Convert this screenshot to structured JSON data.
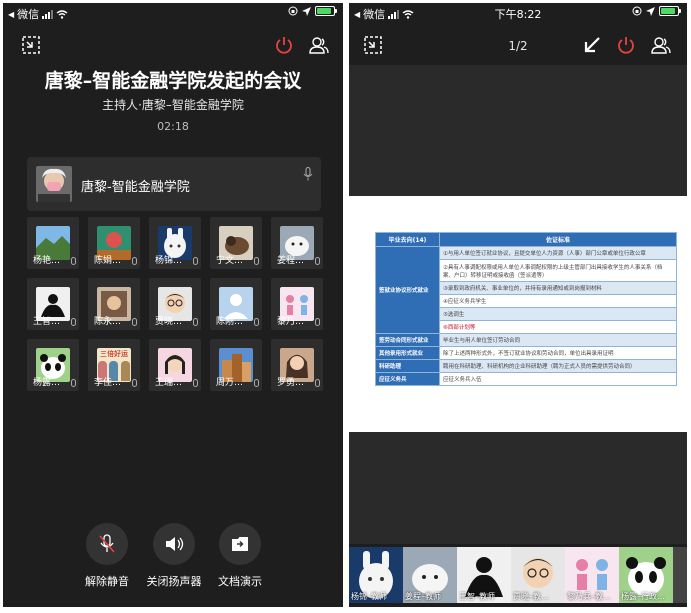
{
  "status_bar": {
    "carrier": "微信",
    "time": "下午8:22"
  },
  "left": {
    "title": "唐黎–智能金融学院发起的会议",
    "host": "主持人·唐黎–智能金融学院",
    "timer": "02:18",
    "host_card_name": "唐黎-智能金融学院",
    "participants": [
      {
        "name": "杨艳…"
      },
      {
        "name": "陈娟…"
      },
      {
        "name": "杨锦…"
      },
      {
        "name": "宁文…"
      },
      {
        "name": "姜程…"
      },
      {
        "name": "王智…"
      },
      {
        "name": "陈永…"
      },
      {
        "name": "贾晓…"
      },
      {
        "name": "陈刚…"
      },
      {
        "name": "黎乃…"
      },
      {
        "name": "杨露…"
      },
      {
        "name": "李佳…"
      },
      {
        "name": "王瑞…"
      },
      {
        "name": "周万…"
      },
      {
        "name": "罗勇…"
      }
    ],
    "tile_overlay_text": "三倍好运",
    "controls": {
      "unmute": "解除静音",
      "speaker_off": "关闭扬声器",
      "doc_share": "文档演示"
    }
  },
  "right": {
    "page_indicator": "1/2",
    "table": {
      "headers": [
        "毕业去向(14)",
        "佐证标准"
      ],
      "group1_label": "签就业协议形式就业",
      "group1_rows": [
        "①与用人单位签订就业协议，且提交单位人力资源（人事）部门公章或单位行政公章",
        "②具有人事调配权限或用人单位人事调配权限的上级主管部门出具接收学生的人事关系（档案、户口）转移证明或接收函（签派遣等）",
        "③录取到政府机关、事业单位的，并持有录用通知或到岗报到材料",
        "④应征义务兵学生",
        "⑤选调生",
        "⑥西部计划等"
      ],
      "other_rows": [
        {
          "label": "签劳动合同形式就业",
          "desc": "毕业生与用人单位签订劳动合同"
        },
        {
          "label": "其他录用形式就业",
          "desc": "除了上述两种形式外，不签订就业协议和劳动合同，单位出具录用证明"
        },
        {
          "label": "科研助理",
          "desc": "聘用在科研助理、科研机构的企业科研助理（聘为正式人员的需提供劳动合同）"
        },
        {
          "label": "应征义务兵",
          "desc": "应征义务兵入伍"
        }
      ]
    },
    "strip": [
      {
        "name": "杨锦–教师"
      },
      {
        "name": "姜程–教师"
      },
      {
        "name": "王智–教师"
      },
      {
        "name": "贾晓–教…"
      },
      {
        "name": "黎乃兵–教…"
      },
      {
        "name": "杨露–行政…"
      }
    ]
  },
  "colors": {
    "bg": "#1e1e1e",
    "tile": "#2d2d2d",
    "table_header": "#2f6db4",
    "red_icon": "#e64340"
  }
}
